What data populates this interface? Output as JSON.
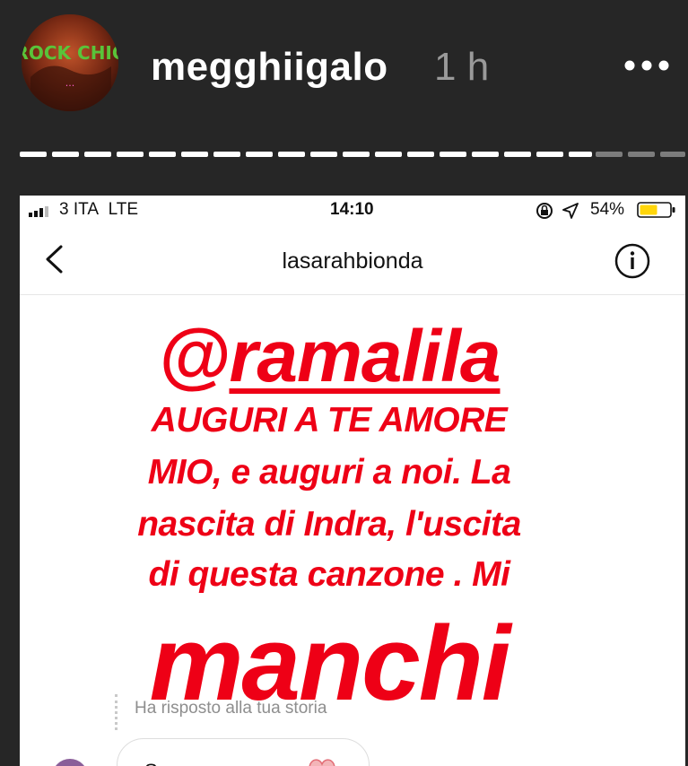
{
  "story": {
    "username": "megghiigalo",
    "timestamp": "1 h",
    "avatar_text": "ROCK CHIC",
    "avatar_subtext": "..."
  },
  "screenshot": {
    "status_bar": {
      "carrier": "3 ITA",
      "network": "LTE",
      "time": "14:10",
      "battery": "54%"
    },
    "header": {
      "title": "lasarahbionda"
    },
    "story_message": {
      "mention_prefix": "@",
      "mention_handle": "ramalila",
      "lines": [
        "AUGURI A TE AMORE",
        "MIO, e auguri a noi. La",
        "nascita di Indra, l'uscita",
        "di questa canzone . Mi"
      ],
      "big_word": "manchi"
    },
    "reply_caption": "Ha risposto alla tua storia",
    "reply_preview": "S..."
  },
  "colors": {
    "background": "#262626",
    "story_text_red": "#ee0016",
    "battery_yellow": "#ffd60a"
  }
}
